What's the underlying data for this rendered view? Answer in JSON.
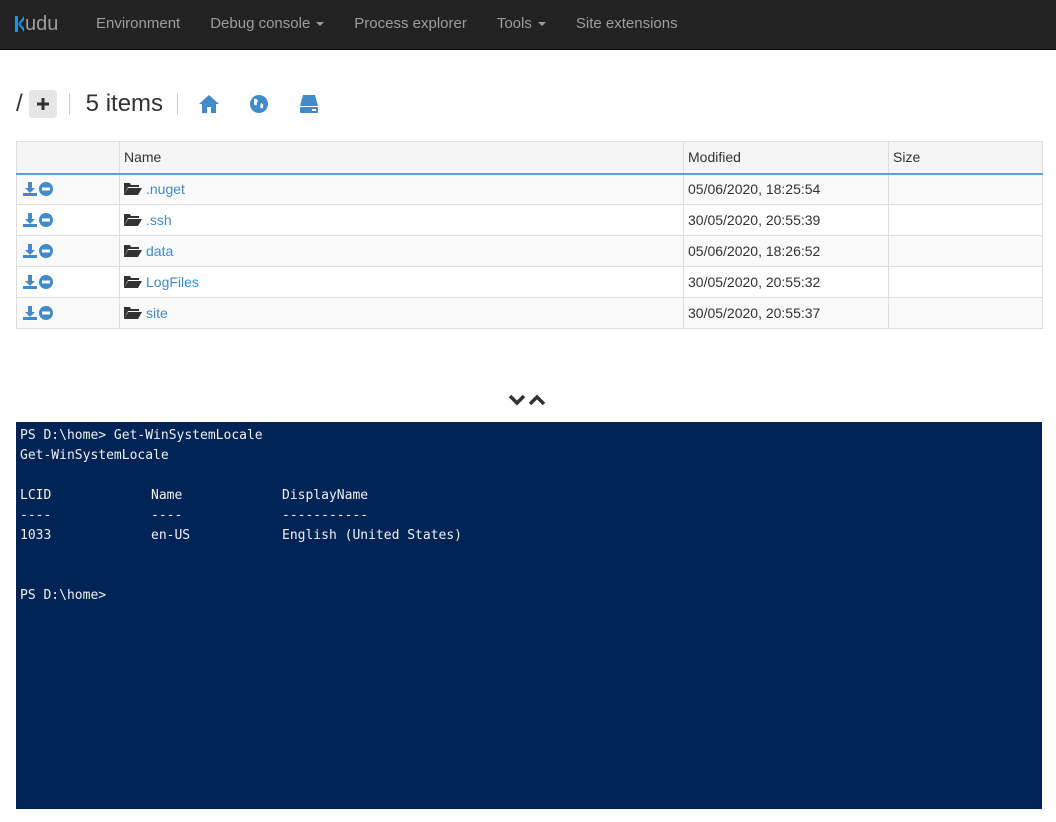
{
  "navbar": {
    "brand": "udu",
    "items": [
      {
        "label": "Environment",
        "dropdown": false
      },
      {
        "label": "Debug console",
        "dropdown": true
      },
      {
        "label": "Process explorer",
        "dropdown": false
      },
      {
        "label": "Tools",
        "dropdown": true
      },
      {
        "label": "Site extensions",
        "dropdown": false
      }
    ]
  },
  "toolbar": {
    "path": "/",
    "items_count": "5 items",
    "icons": [
      "plus-icon",
      "home-icon",
      "globe-icon",
      "drive-icon"
    ]
  },
  "table": {
    "headers": {
      "name": "Name",
      "modified": "Modified",
      "size": "Size"
    },
    "rows": [
      {
        "name": ".nuget",
        "modified": "05/06/2020, 18:25:54",
        "size": ""
      },
      {
        "name": ".ssh",
        "modified": "30/05/2020, 20:55:39",
        "size": ""
      },
      {
        "name": "data",
        "modified": "05/06/2020, 18:26:52",
        "size": ""
      },
      {
        "name": "LogFiles",
        "modified": "30/05/2020, 20:55:32",
        "size": ""
      },
      {
        "name": "site",
        "modified": "30/05/2020, 20:55:37",
        "size": ""
      }
    ]
  },
  "console": {
    "line1": "PS D:\\home> Get-WinSystemLocale",
    "line2": "Get-WinSystemLocale",
    "col_headers": [
      "LCID",
      "Name",
      "DisplayName"
    ],
    "col_dashes": [
      "----",
      "----",
      "-----------"
    ],
    "col_values": [
      "1033",
      "en-US",
      "English (United States)"
    ],
    "prompt": "PS D:\\home>",
    "background": "#012456"
  },
  "colors": {
    "accent": "#428bca",
    "navbar": "#222222",
    "header_border": "#5ba3e0"
  }
}
